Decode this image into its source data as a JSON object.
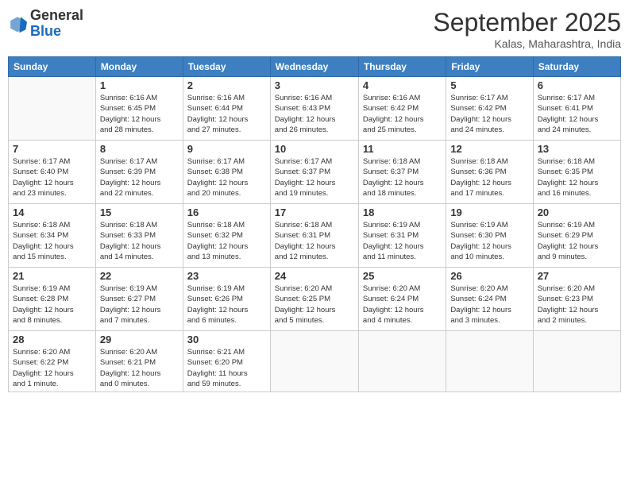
{
  "logo": {
    "general": "General",
    "blue": "Blue"
  },
  "header": {
    "month": "September 2025",
    "location": "Kalas, Maharashtra, India"
  },
  "weekdays": [
    "Sunday",
    "Monday",
    "Tuesday",
    "Wednesday",
    "Thursday",
    "Friday",
    "Saturday"
  ],
  "weeks": [
    [
      {
        "day": "",
        "info": ""
      },
      {
        "day": "1",
        "info": "Sunrise: 6:16 AM\nSunset: 6:45 PM\nDaylight: 12 hours\nand 28 minutes."
      },
      {
        "day": "2",
        "info": "Sunrise: 6:16 AM\nSunset: 6:44 PM\nDaylight: 12 hours\nand 27 minutes."
      },
      {
        "day": "3",
        "info": "Sunrise: 6:16 AM\nSunset: 6:43 PM\nDaylight: 12 hours\nand 26 minutes."
      },
      {
        "day": "4",
        "info": "Sunrise: 6:16 AM\nSunset: 6:42 PM\nDaylight: 12 hours\nand 25 minutes."
      },
      {
        "day": "5",
        "info": "Sunrise: 6:17 AM\nSunset: 6:42 PM\nDaylight: 12 hours\nand 24 minutes."
      },
      {
        "day": "6",
        "info": "Sunrise: 6:17 AM\nSunset: 6:41 PM\nDaylight: 12 hours\nand 24 minutes."
      }
    ],
    [
      {
        "day": "7",
        "info": "Sunrise: 6:17 AM\nSunset: 6:40 PM\nDaylight: 12 hours\nand 23 minutes."
      },
      {
        "day": "8",
        "info": "Sunrise: 6:17 AM\nSunset: 6:39 PM\nDaylight: 12 hours\nand 22 minutes."
      },
      {
        "day": "9",
        "info": "Sunrise: 6:17 AM\nSunset: 6:38 PM\nDaylight: 12 hours\nand 20 minutes."
      },
      {
        "day": "10",
        "info": "Sunrise: 6:17 AM\nSunset: 6:37 PM\nDaylight: 12 hours\nand 19 minutes."
      },
      {
        "day": "11",
        "info": "Sunrise: 6:18 AM\nSunset: 6:37 PM\nDaylight: 12 hours\nand 18 minutes."
      },
      {
        "day": "12",
        "info": "Sunrise: 6:18 AM\nSunset: 6:36 PM\nDaylight: 12 hours\nand 17 minutes."
      },
      {
        "day": "13",
        "info": "Sunrise: 6:18 AM\nSunset: 6:35 PM\nDaylight: 12 hours\nand 16 minutes."
      }
    ],
    [
      {
        "day": "14",
        "info": "Sunrise: 6:18 AM\nSunset: 6:34 PM\nDaylight: 12 hours\nand 15 minutes."
      },
      {
        "day": "15",
        "info": "Sunrise: 6:18 AM\nSunset: 6:33 PM\nDaylight: 12 hours\nand 14 minutes."
      },
      {
        "day": "16",
        "info": "Sunrise: 6:18 AM\nSunset: 6:32 PM\nDaylight: 12 hours\nand 13 minutes."
      },
      {
        "day": "17",
        "info": "Sunrise: 6:18 AM\nSunset: 6:31 PM\nDaylight: 12 hours\nand 12 minutes."
      },
      {
        "day": "18",
        "info": "Sunrise: 6:19 AM\nSunset: 6:31 PM\nDaylight: 12 hours\nand 11 minutes."
      },
      {
        "day": "19",
        "info": "Sunrise: 6:19 AM\nSunset: 6:30 PM\nDaylight: 12 hours\nand 10 minutes."
      },
      {
        "day": "20",
        "info": "Sunrise: 6:19 AM\nSunset: 6:29 PM\nDaylight: 12 hours\nand 9 minutes."
      }
    ],
    [
      {
        "day": "21",
        "info": "Sunrise: 6:19 AM\nSunset: 6:28 PM\nDaylight: 12 hours\nand 8 minutes."
      },
      {
        "day": "22",
        "info": "Sunrise: 6:19 AM\nSunset: 6:27 PM\nDaylight: 12 hours\nand 7 minutes."
      },
      {
        "day": "23",
        "info": "Sunrise: 6:19 AM\nSunset: 6:26 PM\nDaylight: 12 hours\nand 6 minutes."
      },
      {
        "day": "24",
        "info": "Sunrise: 6:20 AM\nSunset: 6:25 PM\nDaylight: 12 hours\nand 5 minutes."
      },
      {
        "day": "25",
        "info": "Sunrise: 6:20 AM\nSunset: 6:24 PM\nDaylight: 12 hours\nand 4 minutes."
      },
      {
        "day": "26",
        "info": "Sunrise: 6:20 AM\nSunset: 6:24 PM\nDaylight: 12 hours\nand 3 minutes."
      },
      {
        "day": "27",
        "info": "Sunrise: 6:20 AM\nSunset: 6:23 PM\nDaylight: 12 hours\nand 2 minutes."
      }
    ],
    [
      {
        "day": "28",
        "info": "Sunrise: 6:20 AM\nSunset: 6:22 PM\nDaylight: 12 hours\nand 1 minute."
      },
      {
        "day": "29",
        "info": "Sunrise: 6:20 AM\nSunset: 6:21 PM\nDaylight: 12 hours\nand 0 minutes."
      },
      {
        "day": "30",
        "info": "Sunrise: 6:21 AM\nSunset: 6:20 PM\nDaylight: 11 hours\nand 59 minutes."
      },
      {
        "day": "",
        "info": ""
      },
      {
        "day": "",
        "info": ""
      },
      {
        "day": "",
        "info": ""
      },
      {
        "day": "",
        "info": ""
      }
    ]
  ]
}
